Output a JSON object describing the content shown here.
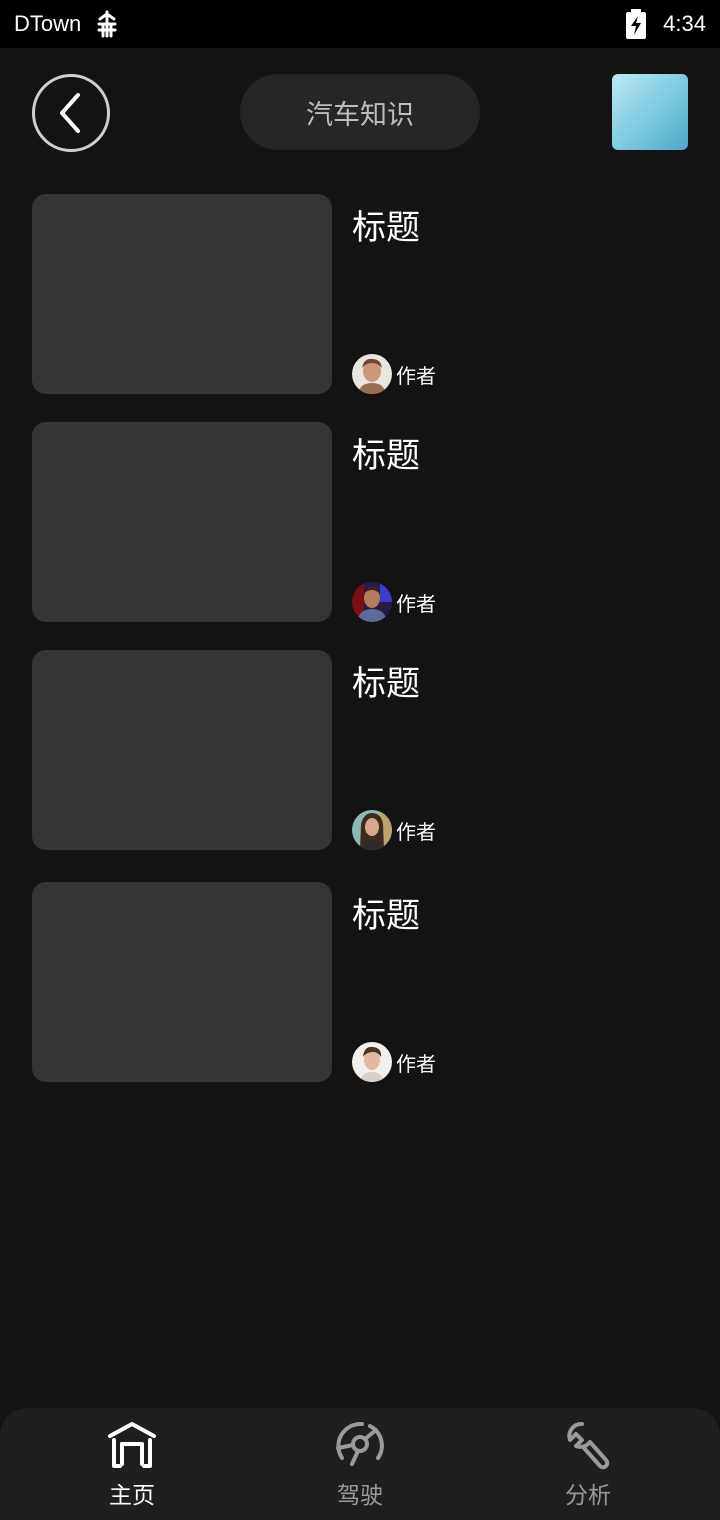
{
  "status_bar": {
    "carrier": "DTown",
    "time": "4:34",
    "network_icon": "network-signal-icon",
    "battery_icon": "battery-charging-icon"
  },
  "header": {
    "title": "汽车知识",
    "back_icon": "chevron-left-icon"
  },
  "articles": [
    {
      "title": "标题",
      "author": "作者"
    },
    {
      "title": "标题",
      "author": "作者"
    },
    {
      "title": "标题",
      "author": "作者"
    },
    {
      "title": "标题",
      "author": "作者"
    }
  ],
  "bottom_nav": {
    "items": [
      {
        "label": "主页",
        "icon": "home-icon",
        "active": true
      },
      {
        "label": "驾驶",
        "icon": "steering-wheel-icon",
        "active": false
      },
      {
        "label": "分析",
        "icon": "wrench-icon",
        "active": false
      }
    ]
  },
  "colors": {
    "background": "#131313",
    "card_thumb": "#353535",
    "nav_background": "#1f1f1f",
    "nav_active": "#ffffff",
    "nav_inactive": "#9a9a9a"
  }
}
